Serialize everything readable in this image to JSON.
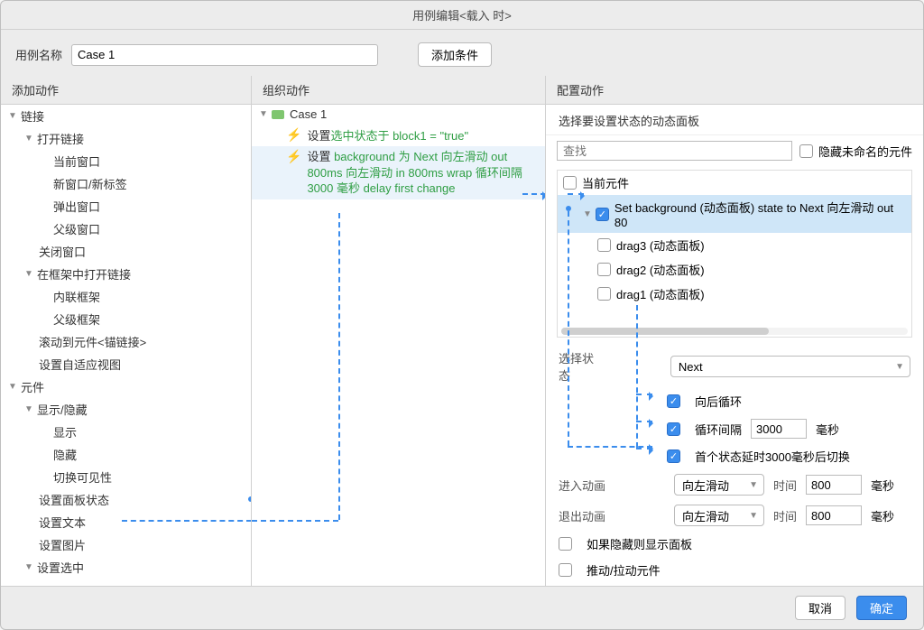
{
  "window": {
    "title": "用例编辑<载入 时>"
  },
  "top": {
    "name_label": "用例名称",
    "name_value": "Case 1",
    "add_condition": "添加条件"
  },
  "col_titles": {
    "add_action": "添加动作",
    "org_action": "组织动作",
    "config_action": "配置动作"
  },
  "left_tree": {
    "links": "链接",
    "open_link": "打开链接",
    "current_window": "当前窗口",
    "new_window": "新窗口/新标签",
    "popup_window": "弹出窗口",
    "parent_window": "父级窗口",
    "close_window": "关闭窗口",
    "open_in_frame": "在框架中打开链接",
    "inline_frame": "内联框架",
    "parent_frame": "父级框架",
    "scroll_to_anchor": "滚动到元件<锚链接>",
    "set_adaptive": "设置自适应视图",
    "widgets": "元件",
    "show_hide": "显示/隐藏",
    "show": "显示",
    "hide": "隐藏",
    "toggle_vis": "切换可见性",
    "set_panel_state": "设置面板状态",
    "set_text": "设置文本",
    "set_image": "设置图片",
    "set_selected": "设置选中"
  },
  "mid_tree": {
    "case1": "Case 1",
    "line1a": "设置 ",
    "line1b": "选中状态于 block1 = \"true\"",
    "line2a": "设置 ",
    "line2b": "background 为 Next 向左滑动 out 800ms 向左滑动 in 800ms wrap 循环间隔 3000 毫秒 delay first change"
  },
  "right": {
    "panel_title": "选择要设置状态的动态面板",
    "search_placeholder": "查找",
    "hide_unnamed": "隐藏未命名的元件",
    "current_widget": "当前元件",
    "bg_item": "Set background (动态面板) state to Next 向左滑动 out 80",
    "drag3": "drag3 (动态面板)",
    "drag2": "drag2 (动态面板)",
    "drag1": "drag1 (动态面板)",
    "select_state_label": "选择状态",
    "select_state_value": "Next",
    "loop_back": "向后循环",
    "loop_interval": "循环间隔",
    "loop_interval_value": "3000",
    "ms": "毫秒",
    "first_state_delay": "首个状态延时3000毫秒后切换",
    "enter_anim": "进入动画",
    "exit_anim": "退出动画",
    "slide_left": "向左滑动",
    "time": "时间",
    "time_in": "800",
    "time_out": "800",
    "show_if_hidden": "如果隐藏则显示面板",
    "push_pull": "推动/拉动元件"
  },
  "footer": {
    "cancel": "取消",
    "ok": "确定"
  }
}
